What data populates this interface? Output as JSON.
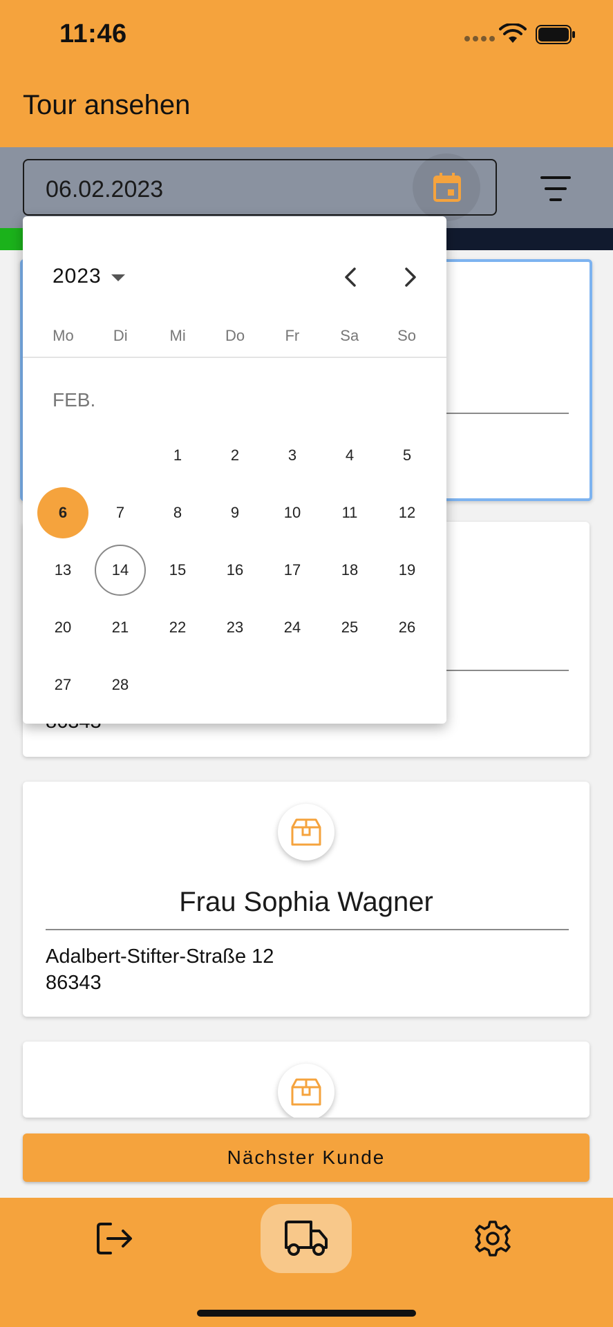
{
  "status_bar": {
    "time": "11:46"
  },
  "app_bar": {
    "title": "Tour ansehen"
  },
  "filter": {
    "date_value": "06.02.2023"
  },
  "cards": [
    {
      "name": "",
      "street": "",
      "zip": ""
    },
    {
      "name": "",
      "street": "",
      "zip": "86343"
    },
    {
      "name": "Frau Sophia Wagner",
      "street": "Adalbert-Stifter-Straße 12",
      "zip": "86343"
    },
    {
      "name": "",
      "street": "",
      "zip": ""
    }
  ],
  "date_picker": {
    "year": "2023",
    "month_label": "FEB.",
    "weekdays": [
      "Mo",
      "Di",
      "Mi",
      "Do",
      "Fr",
      "Sa",
      "So"
    ],
    "first_weekday_index": 2,
    "days_in_month": 28,
    "selected_day": 6,
    "today_day": 14
  },
  "next_button": {
    "label": "Nächster Kunde"
  },
  "colors": {
    "accent": "#f5a33d",
    "header_gray": "#8a92a0",
    "selection_border": "#7db3f0"
  },
  "nav": [
    {
      "icon": "logout-icon",
      "active": false
    },
    {
      "icon": "truck-icon",
      "active": true
    },
    {
      "icon": "gear-icon",
      "active": false
    }
  ]
}
